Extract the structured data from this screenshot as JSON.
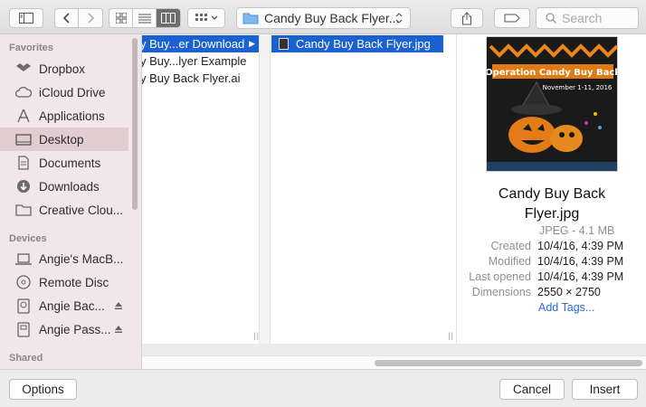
{
  "toolbar": {
    "path_popup_label": "Candy Buy Back Flyer...",
    "search_placeholder": "Search"
  },
  "sidebar": {
    "sections": [
      {
        "title": "Favorites"
      },
      {
        "title": "Devices"
      },
      {
        "title": "Shared"
      }
    ],
    "favorites": [
      {
        "label": "Dropbox",
        "icon": "dropbox-icon"
      },
      {
        "label": "iCloud Drive",
        "icon": "cloud-icon"
      },
      {
        "label": "Applications",
        "icon": "applications-icon"
      },
      {
        "label": "Desktop",
        "icon": "desktop-icon",
        "selected": true
      },
      {
        "label": "Documents",
        "icon": "document-icon"
      },
      {
        "label": "Downloads",
        "icon": "download-icon"
      },
      {
        "label": "Creative Clou...",
        "icon": "folder-icon"
      }
    ],
    "devices": [
      {
        "label": "Angie's MacB...",
        "icon": "laptop-icon"
      },
      {
        "label": "Remote Disc",
        "icon": "disc-icon"
      },
      {
        "label": "Angie Bac...",
        "icon": "drive-icon",
        "eject": true
      },
      {
        "label": "Angie Pass...",
        "icon": "drive-icon",
        "eject": true
      }
    ]
  },
  "columns": {
    "col1": [
      "y Buy...er Download",
      "y Buy...lyer Example",
      "y Buy Back Flyer.ai"
    ],
    "col2": [
      "Candy Buy Back Flyer.jpg"
    ]
  },
  "preview": {
    "name_line1": "Candy Buy Back",
    "name_line2": "Flyer.jpg",
    "kind_size": "JPEG - 4.1 MB",
    "created_label": "Created",
    "created_value": "10/4/16, 4:39 PM",
    "modified_label": "Modified",
    "modified_value": "10/4/16, 4:39 PM",
    "last_opened_label": "Last opened",
    "last_opened_value": "10/4/16, 4:39 PM",
    "dimensions_label": "Dimensions",
    "dimensions_value": "2550 × 2750",
    "add_tags": "Add Tags...",
    "flyer_title": "Operation Candy Buy Back",
    "flyer_date": "November 1-11, 2016"
  },
  "buttons": {
    "options": "Options",
    "cancel": "Cancel",
    "insert": "Insert"
  },
  "colors": {
    "selection": "#1b62d1",
    "sidebar_bg": "#f1e7ea",
    "link": "#2a6bd8"
  }
}
